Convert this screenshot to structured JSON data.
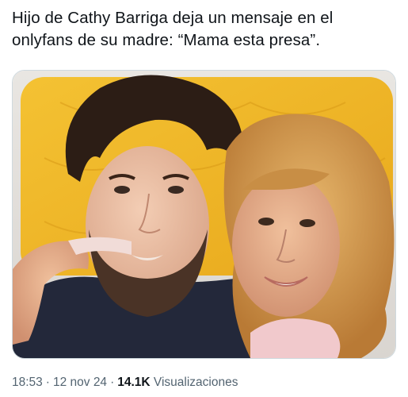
{
  "tweet": {
    "text_lines": [
      "Hijo de Cathy Barriga  deja un mensaje en el",
      "onlyfans de su madre: “Mama esta presa”."
    ],
    "media": {
      "description_icon": "photo-icon"
    },
    "meta": {
      "time": "18:53",
      "separator": "·",
      "date": "12 nov 24",
      "views_count": "14.1K",
      "views_label": "Visualizaciones"
    }
  },
  "colors": {
    "text_primary": "#0f1419",
    "text_secondary": "#536471",
    "media_border": "#cfd9de",
    "backdrop_yellow": "#f2b627"
  }
}
